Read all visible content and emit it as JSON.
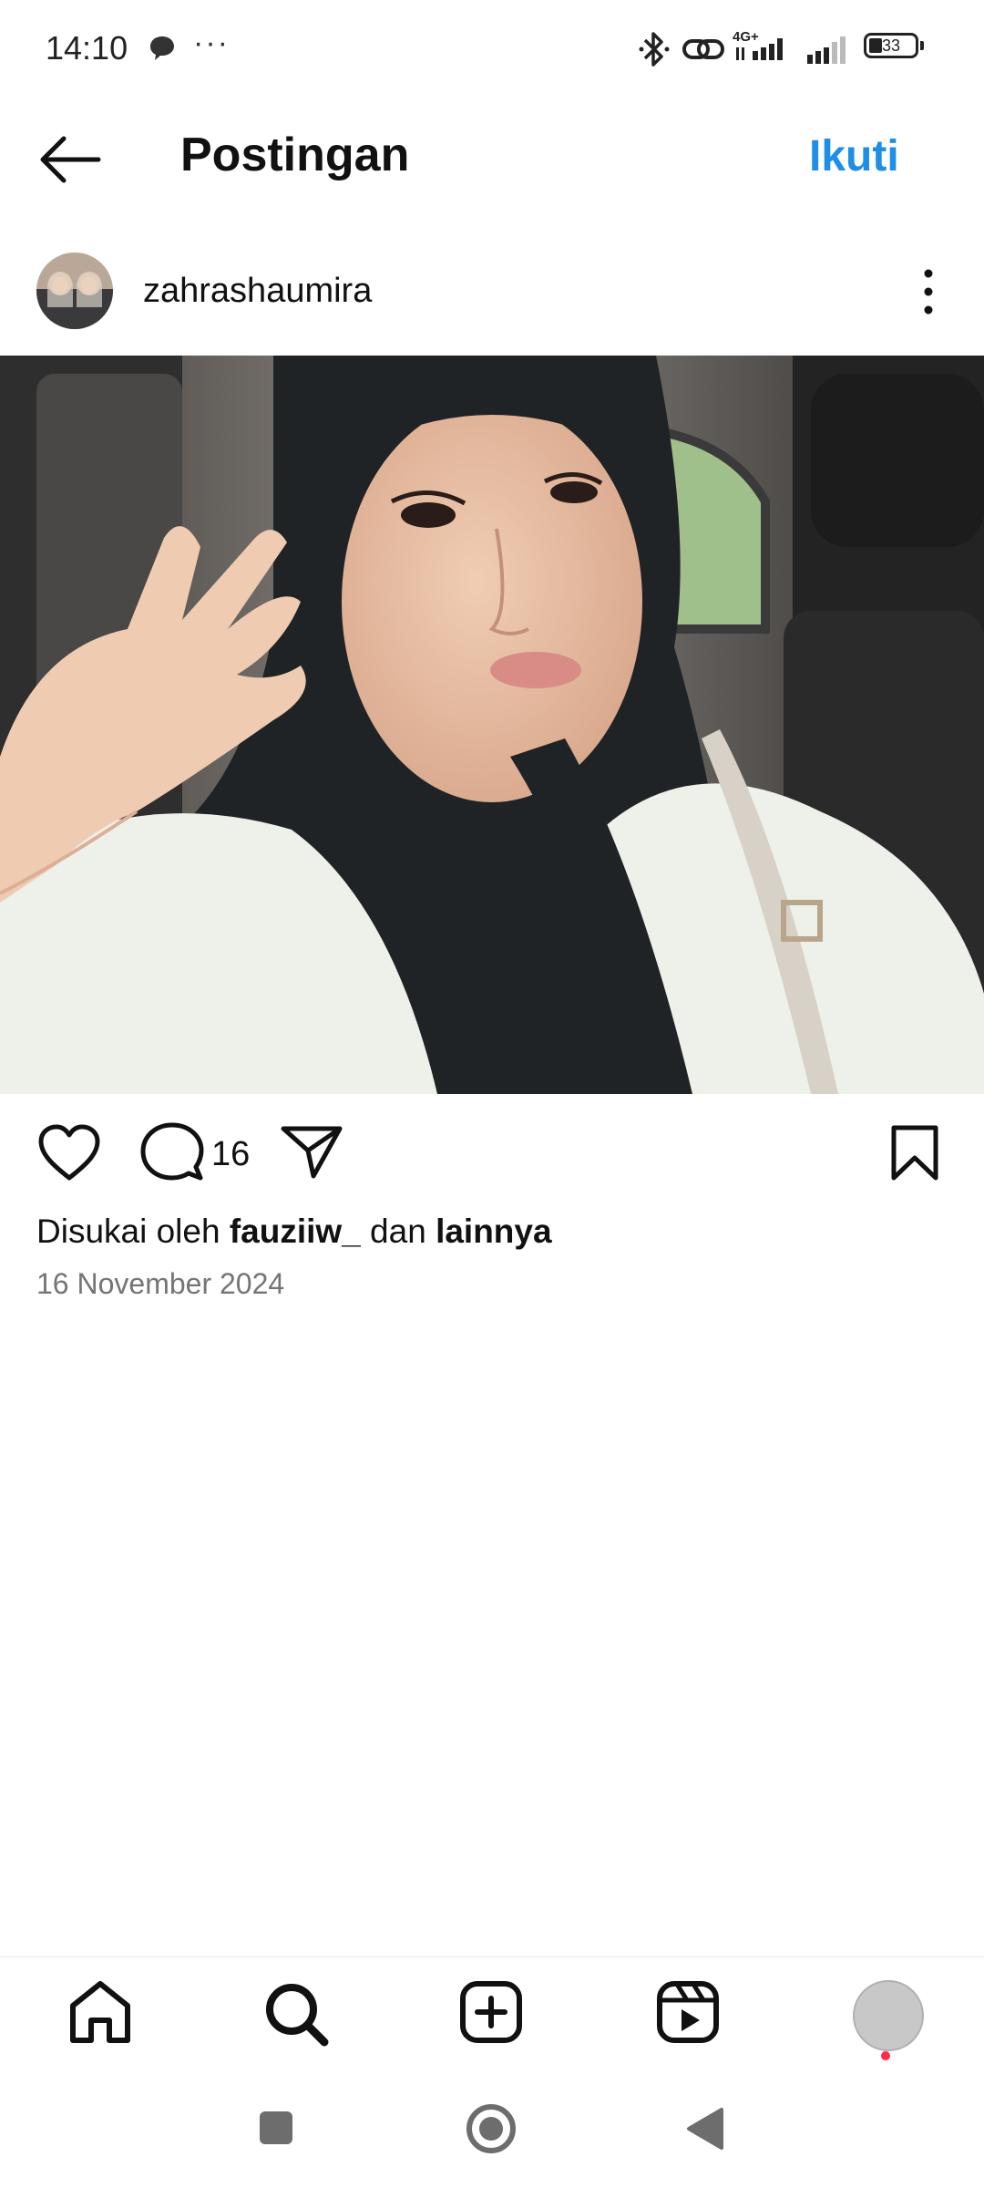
{
  "status_bar": {
    "time": "14:10",
    "more": "···",
    "network": "4G+",
    "battery": "33"
  },
  "header": {
    "title": "Postingan",
    "follow_label": "Ikuti"
  },
  "post": {
    "username": "zahrashaumira",
    "comment_count": "16",
    "liked_prefix": "Disukai oleh ",
    "liked_user": "fauziiw_",
    "liked_mid": " dan ",
    "liked_suffix": "lainnya",
    "date": "16 November 2024"
  },
  "icons": {
    "back": "arrow-left-icon",
    "like": "heart-icon",
    "comment": "comment-bubble-icon",
    "share": "paper-plane-icon",
    "save": "bookmark-icon",
    "more": "vertical-dots-icon",
    "nav": [
      "home-icon",
      "search-icon",
      "add-post-icon",
      "reels-icon",
      "profile-avatar"
    ]
  },
  "colors": {
    "accent": "#1f8fe6",
    "notification_dot": "#ff2a4a",
    "text_secondary": "#757575"
  }
}
